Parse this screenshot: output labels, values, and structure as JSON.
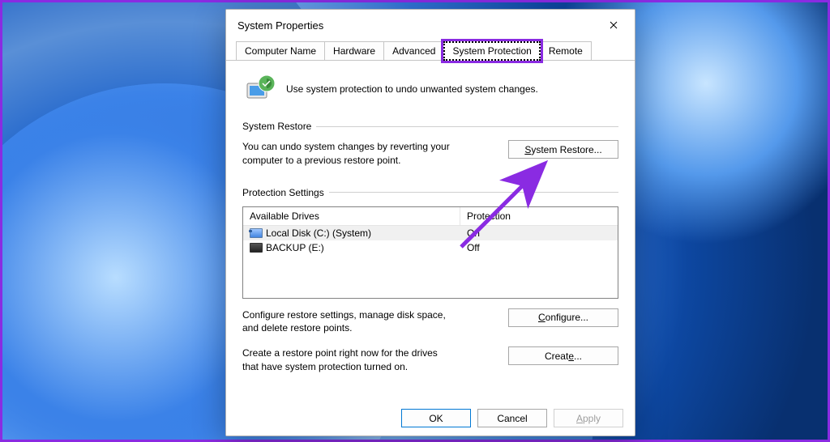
{
  "window": {
    "title": "System Properties"
  },
  "tabs": [
    {
      "label": "Computer Name"
    },
    {
      "label": "Hardware"
    },
    {
      "label": "Advanced"
    },
    {
      "label": "System Protection"
    },
    {
      "label": "Remote"
    }
  ],
  "intro": "Use system protection to undo unwanted system changes.",
  "restore": {
    "group": "System Restore",
    "desc": "You can undo system changes by reverting your computer to a previous restore point.",
    "button_prefix": "S",
    "button_rest": "ystem Restore..."
  },
  "protection": {
    "group": "Protection Settings",
    "col1": "Available Drives",
    "col2": "Protection",
    "drives": [
      {
        "name": "Local Disk (C:) (System)",
        "status": "On"
      },
      {
        "name": "BACKUP (E:)",
        "status": "Off"
      }
    ],
    "configure_desc": "Configure restore settings, manage disk space, and delete restore points.",
    "configure_prefix": "C",
    "configure_rest": "onfigure...",
    "create_desc": "Create a restore point right now for the drives that have system protection turned on.",
    "create_prefix": "Creat",
    "create_letter": "e",
    "create_rest": "..."
  },
  "buttons": {
    "ok": "OK",
    "cancel": "Cancel",
    "apply_prefix": "A",
    "apply_rest": "pply"
  }
}
